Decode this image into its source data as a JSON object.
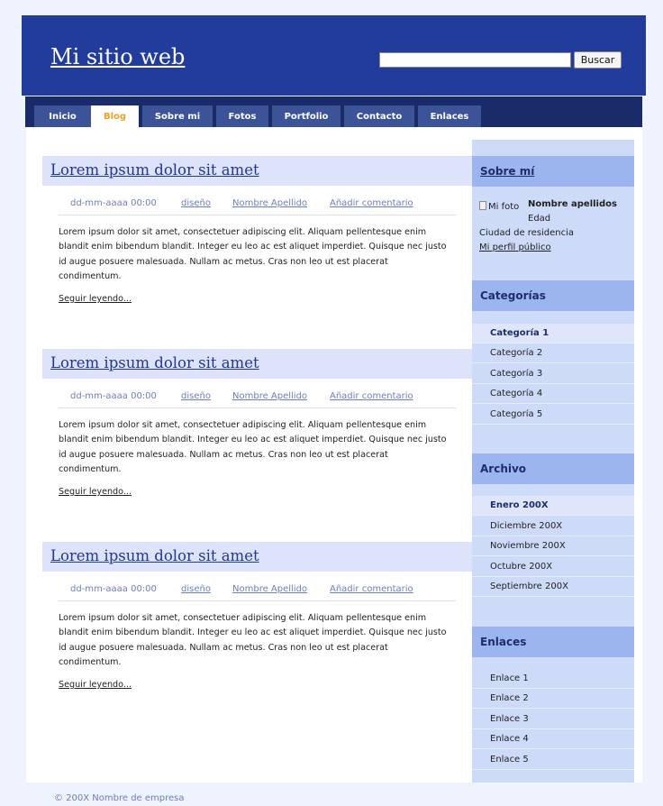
{
  "header": {
    "site_title": "Mi sitio web",
    "search_placeholder": "",
    "search_button": "Buscar"
  },
  "nav": {
    "tabs": [
      {
        "label": "Inicio"
      },
      {
        "label": "Blog",
        "active": true
      },
      {
        "label": "Sobre mi"
      },
      {
        "label": "Fotos"
      },
      {
        "label": "Portfolio"
      },
      {
        "label": "Contacto"
      },
      {
        "label": "Enlaces"
      }
    ]
  },
  "posts": [
    {
      "title": "Lorem ipsum dolor sit amet",
      "date": "dd-mm-aaaa 00:00",
      "category": "diseño",
      "author": "Nombre Apellido",
      "comment_link": "Añadir comentario",
      "body": "Lorem ipsum dolor sit amet, consectetuer adipiscing elit. Aliquam pellentesque enim blandit enim bibendum blandit. Integer eu leo ac est aliquet imperdiet. Quisque nec justo id augue posuere malesuada. Nullam ac metus. Cras non leo ut est placerat condimentum.",
      "read_more": "Seguir leyendo..."
    },
    {
      "title": "Lorem ipsum dolor sit amet",
      "date": "dd-mm-aaaa 00:00",
      "category": "diseño",
      "author": "Nombre Apellido",
      "comment_link": "Añadir comentario",
      "body": "Lorem ipsum dolor sit amet, consectetuer adipiscing elit. Aliquam pellentesque enim blandit enim bibendum blandit. Integer eu leo ac est aliquet imperdiet. Quisque nec justo id augue posuere malesuada. Nullam ac metus. Cras non leo ut est placerat condimentum.",
      "read_more": "Seguir leyendo..."
    },
    {
      "title": "Lorem ipsum dolor sit amet",
      "date": "dd-mm-aaaa 00:00",
      "category": "diseño",
      "author": "Nombre Apellido",
      "comment_link": "Añadir comentario",
      "body": "Lorem ipsum dolor sit amet, consectetuer adipiscing elit. Aliquam pellentesque enim blandit enim bibendum blandit. Integer eu leo ac est aliquet imperdiet. Quisque nec justo id augue posuere malesuada. Nullam ac metus. Cras non leo ut est placerat condimentum.",
      "read_more": "Seguir leyendo..."
    }
  ],
  "sidebar": {
    "about": {
      "heading": "Sobre mí",
      "photo_alt": "Mi foto",
      "name": "Nombre apellidos",
      "age": "Edad",
      "city": "Ciudad de residencia",
      "profile_link": "Mi perfil público"
    },
    "categories": {
      "heading": "Categorías",
      "items": [
        {
          "label": "Categoría 1",
          "active": true
        },
        {
          "label": "Categoría 2"
        },
        {
          "label": "Categoría 3"
        },
        {
          "label": "Categoría 4"
        },
        {
          "label": "Categoría 5"
        }
      ]
    },
    "archive": {
      "heading": "Archivo",
      "items": [
        {
          "label": "Enero 200X",
          "active": true
        },
        {
          "label": "Diciembre 200X"
        },
        {
          "label": "Noviembre 200X"
        },
        {
          "label": "Octubre 200X"
        },
        {
          "label": "Septiembre 200X"
        }
      ]
    },
    "links": {
      "heading": "Enlaces",
      "items": [
        {
          "label": "Enlace 1"
        },
        {
          "label": "Enlace 2"
        },
        {
          "label": "Enlace 3"
        },
        {
          "label": "Enlace 4"
        },
        {
          "label": "Enlace 5"
        }
      ]
    }
  },
  "footer": {
    "copyright": "© 200X Nombre de empresa"
  },
  "colors": {
    "header_bg": "#213c9b",
    "nav_bg": "#1a2b6a",
    "tab_bg": "#3d5397",
    "tab_active_text": "#f0a022",
    "post_title_bg": "#dce3fb",
    "sidebar_bg": "#cddbf9",
    "sidebar_heading_bg": "#9db5ef",
    "page_bg": "#eff3fd"
  }
}
